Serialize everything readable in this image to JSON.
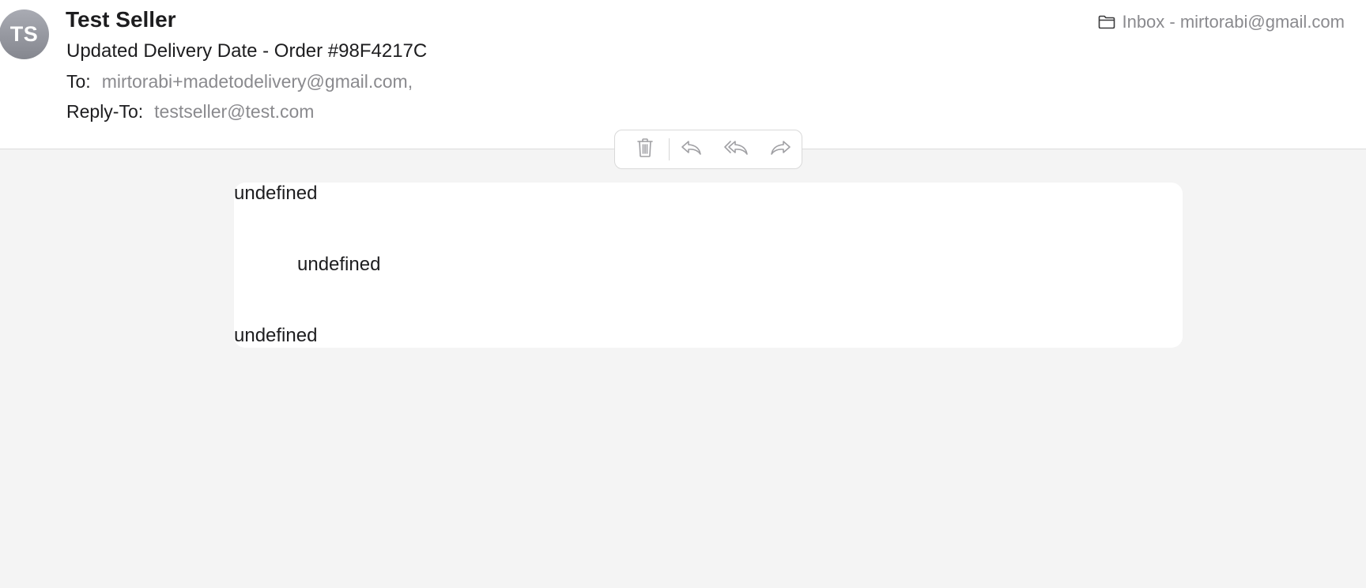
{
  "message": {
    "avatar_initials": "TS",
    "sender_name": "Test Seller",
    "subject": "Updated Delivery Date - Order #98F4217C",
    "to_label": "To:",
    "to_value": "mirtorabi+madetodelivery@gmail.com,",
    "reply_to_label": "Reply-To:",
    "reply_to_value": "testseller@test.com",
    "mailbox": "Inbox - mirtorabi@gmail.com",
    "mailbox_icon": "folder-icon"
  },
  "toolbar": {
    "actions": [
      {
        "icon": "trash-icon"
      },
      {
        "icon": "reply-icon"
      },
      {
        "icon": "reply-all-icon"
      },
      {
        "icon": "forward-icon"
      }
    ],
    "icon_color": "#a0a0a4"
  },
  "body": {
    "lines": [
      "undefined",
      "undefined",
      "undefined"
    ]
  },
  "colors": {
    "header_bg": "#ffffff",
    "content_bg": "#f4f4f4",
    "secondary_text": "#8a8a8e"
  }
}
